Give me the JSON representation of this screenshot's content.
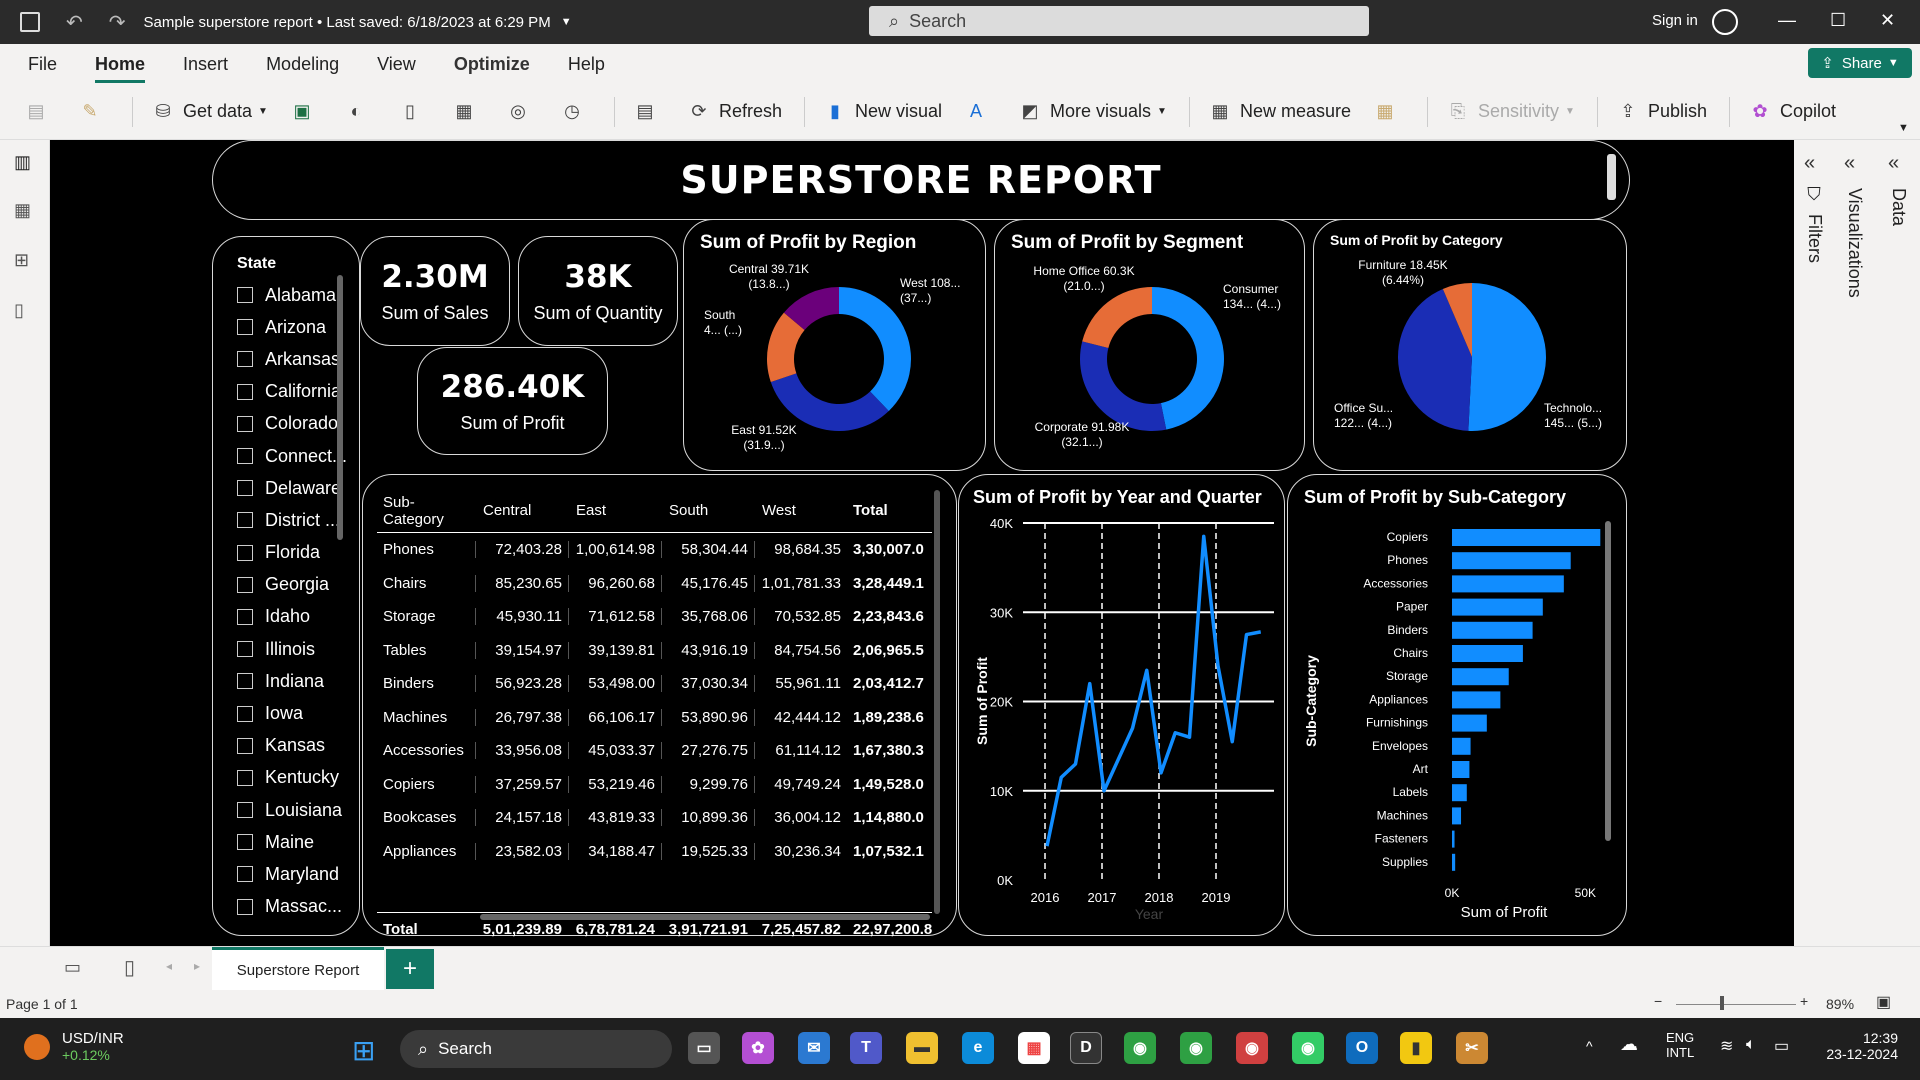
{
  "app": {
    "title": "Sample superstore report • Last saved: 6/18/2023 at 6:29 PM",
    "search_placeholder": "Search",
    "signin": "Sign in",
    "share": "Share"
  },
  "menu": [
    "File",
    "Home",
    "Insert",
    "Modeling",
    "View",
    "Optimize",
    "Help"
  ],
  "ribbon": {
    "get_data": "Get data",
    "refresh": "Refresh",
    "new_visual": "New visual",
    "more_visuals": "More visuals",
    "new_measure": "New measure",
    "sensitivity": "Sensitivity",
    "publish": "Publish",
    "copilot": "Copilot"
  },
  "right_panel": [
    "Filters",
    "Visualizations",
    "Data"
  ],
  "report": {
    "title": "SUPERSTORE REPORT",
    "state_slicer": {
      "header": "State",
      "items": [
        "Alabama",
        "Arizona",
        "Arkansas",
        "California",
        "Colorado",
        "Connect...",
        "Delaware",
        "District ...",
        "Florida",
        "Georgia",
        "Idaho",
        "Illinois",
        "Indiana",
        "Iowa",
        "Kansas",
        "Kentucky",
        "Louisiana",
        "Maine",
        "Maryland",
        "Massac..."
      ]
    },
    "kpis": {
      "sales": {
        "value": "2.30M",
        "label": "Sum of Sales"
      },
      "quantity": {
        "value": "38K",
        "label": "Sum of Quantity"
      },
      "profit": {
        "value": "286.40K",
        "label": "Sum of Profit"
      }
    },
    "colors": {
      "dark_blue": "#1a2db5",
      "blue": "#118dff",
      "orange": "#e66c37",
      "purple": "#6b007b"
    }
  },
  "chart_data": [
    {
      "type": "pie",
      "title": "Sum of Profit by Region",
      "slices": [
        {
          "label": "West",
          "value": 108418.45,
          "text": "West 108... (37...)"
        },
        {
          "label": "East",
          "value": 91522.78,
          "text": "East 91.52K (31.9...)"
        },
        {
          "label": "South",
          "value": 46749.43,
          "text": "South 4... (...)"
        },
        {
          "label": "Central",
          "value": 39706.36,
          "text": "Central 39.71K (13.8...)"
        }
      ]
    },
    {
      "type": "pie",
      "title": "Sum of Profit by Segment",
      "slices": [
        {
          "label": "Consumer",
          "value": 134119.21,
          "text": "Consumer 134... (4...)"
        },
        {
          "label": "Corporate",
          "value": 91979.13,
          "text": "Corporate 91.98K (32.1...)"
        },
        {
          "label": "Home Office",
          "value": 60298.68,
          "text": "Home Office 60.3K (21.0...)"
        }
      ]
    },
    {
      "type": "pie",
      "title": "Sum of Profit by Category",
      "slices": [
        {
          "label": "Technology",
          "value": 145454.95,
          "text": "Technolo... 145... (5...)"
        },
        {
          "label": "Office Supplies",
          "value": 122490.8,
          "text": "Office Su... 122... (4...)"
        },
        {
          "label": "Furniture",
          "value": 18451.27,
          "text": "Furniture 18.45K (6.44%)"
        }
      ]
    },
    {
      "type": "table",
      "columns": [
        "Sub-Category",
        "Central",
        "East",
        "South",
        "West",
        "Total"
      ],
      "rows": [
        [
          "Phones",
          "72,403.28",
          "1,00,614.98",
          "58,304.44",
          "98,684.35",
          "3,30,007.0"
        ],
        [
          "Chairs",
          "85,230.65",
          "96,260.68",
          "45,176.45",
          "1,01,781.33",
          "3,28,449.1"
        ],
        [
          "Storage",
          "45,930.11",
          "71,612.58",
          "35,768.06",
          "70,532.85",
          "2,23,843.6"
        ],
        [
          "Tables",
          "39,154.97",
          "39,139.81",
          "43,916.19",
          "84,754.56",
          "2,06,965.5"
        ],
        [
          "Binders",
          "56,923.28",
          "53,498.00",
          "37,030.34",
          "55,961.11",
          "2,03,412.7"
        ],
        [
          "Machines",
          "26,797.38",
          "66,106.17",
          "53,890.96",
          "42,444.12",
          "1,89,238.6"
        ],
        [
          "Accessories",
          "33,956.08",
          "45,033.37",
          "27,276.75",
          "61,114.12",
          "1,67,380.3"
        ],
        [
          "Copiers",
          "37,259.57",
          "53,219.46",
          "9,299.76",
          "49,749.24",
          "1,49,528.0"
        ],
        [
          "Bookcases",
          "24,157.18",
          "43,819.33",
          "10,899.36",
          "36,004.12",
          "1,14,880.0"
        ],
        [
          "Appliances",
          "23,582.03",
          "34,188.47",
          "19,525.33",
          "30,236.34",
          "1,07,532.1"
        ]
      ],
      "total": [
        "Total",
        "5,01,239.89",
        "6,78,781.24",
        "3,91,721.91",
        "7,25,457.82",
        "22,97,200.8"
      ]
    },
    {
      "type": "line",
      "title": "Sum of Profit by Year and Quarter",
      "xlabel": "Year",
      "ylabel": "Sum of Profit",
      "x_ticks": [
        "2016",
        "2017",
        "2018",
        "2019"
      ],
      "y_ticks": [
        "0K",
        "10K",
        "20K",
        "30K",
        "40K"
      ],
      "ylim": [
        0,
        40000
      ],
      "series": [
        {
          "values": [
            3800,
            11500,
            13000,
            22000,
            10000,
            13500,
            17000,
            23500,
            12000,
            16500,
            16000,
            38500,
            24000,
            15500,
            27500,
            27800
          ]
        }
      ]
    },
    {
      "type": "bar",
      "orientation": "horizontal",
      "title": "Sum of Profit by Sub-Category",
      "xlabel": "Sum of Profit",
      "ylabel": "Sub-Category",
      "x_ticks": [
        "0K",
        "50K"
      ],
      "xlim": [
        0,
        60000
      ],
      "categories": [
        "Copiers",
        "Phones",
        "Accessories",
        "Paper",
        "Binders",
        "Chairs",
        "Storage",
        "Appliances",
        "Furnishings",
        "Envelopes",
        "Art",
        "Labels",
        "Machines",
        "Fasteners",
        "Supplies"
      ],
      "values": [
        55618,
        44516,
        41937,
        34053,
        30222,
        26590,
        21279,
        18138,
        13059,
        6964,
        6528,
        5546,
        3385,
        950,
        1190
      ]
    }
  ],
  "pagebar": {
    "tab": "Superstore Report",
    "add": "+"
  },
  "status": {
    "page": "Page 1 of 1",
    "zoom": "89%"
  },
  "taskbar": {
    "ticker": "USD/INR",
    "ticker_change": "+0.12%",
    "search": "Search",
    "lang1": "ENG",
    "lang2": "INTL",
    "time": "12:39",
    "date": "23-12-2024"
  }
}
